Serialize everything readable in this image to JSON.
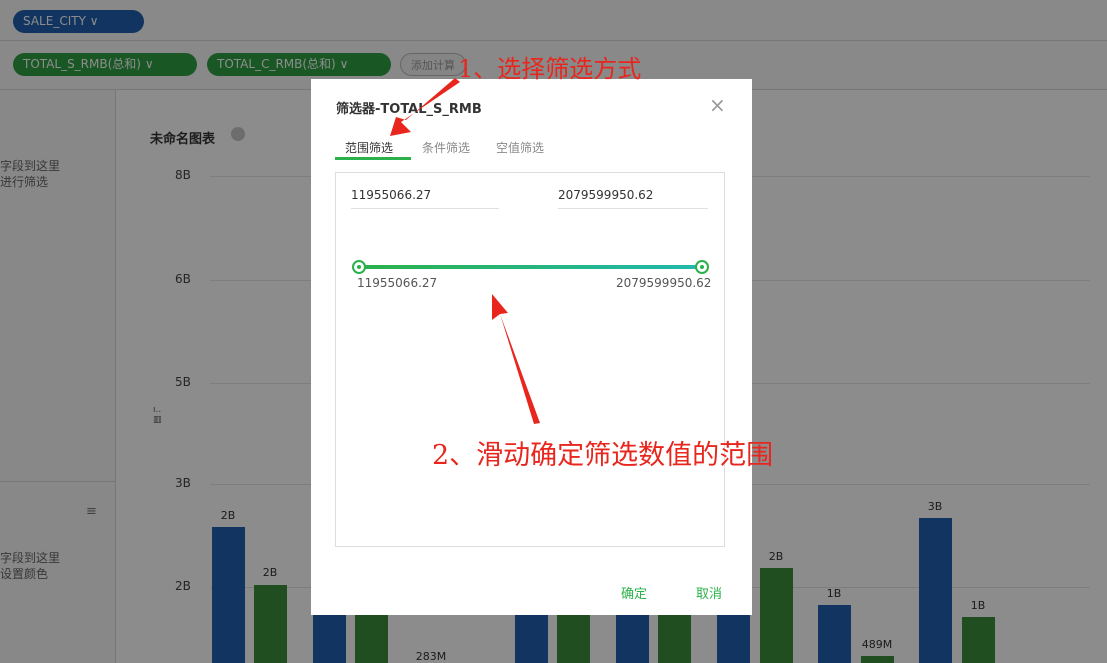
{
  "header": {
    "dimension_pill": "SALE_CITY",
    "measure_pills": [
      "TOTAL_S_RMB(总和)",
      "TOTAL_C_RMB(总和)"
    ],
    "add_calc_label": "添加计算"
  },
  "side_panel": {
    "hint1_line1": "字段到这里",
    "hint1_line2": "进行筛选",
    "hint2_line1": "字段到这里",
    "hint2_line2": "设置颜色"
  },
  "chart": {
    "title": "未命名图表",
    "y_ticks": [
      "8B",
      "6B",
      "5B",
      "3B",
      "2B"
    ]
  },
  "chart_data": {
    "type": "bar",
    "title": "未命名图表",
    "ytick_labels": [
      "8B",
      "6B",
      "5B",
      "3B",
      "2B"
    ],
    "series": [
      {
        "color": "#1f5fb0"
      },
      {
        "color": "#3c8f3c"
      }
    ],
    "visible_bar_labels": [
      "2B",
      "2B",
      "283M",
      "2B",
      "1B",
      "489M",
      "3B",
      "1B"
    ]
  },
  "modal": {
    "title": "筛选器-TOTAL_S_RMB",
    "tabs": [
      "范围筛选",
      "条件筛选",
      "空值筛选"
    ],
    "min_value": "11955066.27",
    "max_value": "2079599950.62",
    "slider_min_label": "11955066.27",
    "slider_max_label": "2079599950.62",
    "confirm_label": "确定",
    "cancel_label": "取消"
  },
  "annotations": {
    "step1": "1、选择筛选方式",
    "step2": "2、滑动确定筛选数值的范围"
  },
  "colors": {
    "blue": "#1f5fb0",
    "green": "#2f9e44",
    "annotation": "#e8261d"
  }
}
